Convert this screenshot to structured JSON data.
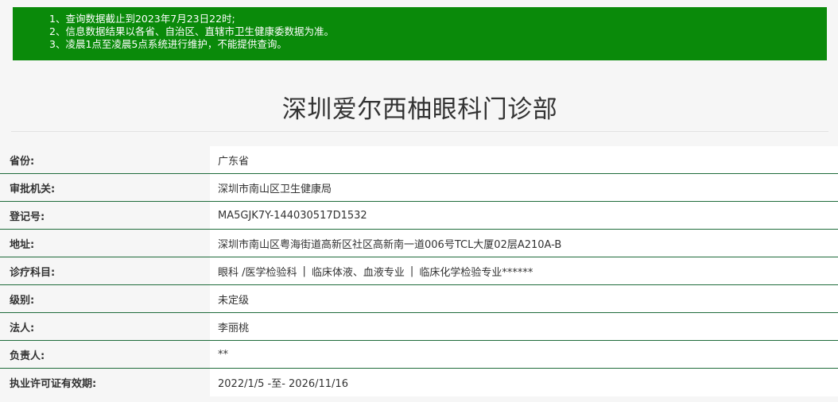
{
  "notice": {
    "lines": [
      "1、查询数据截止到2023年7月23日22时;",
      "2、信息数据结果以各省、自治区、直辖市卫生健康委数据为准。",
      "3、凌晨1点至凌晨5点系统进行维护，不能提供查询。"
    ]
  },
  "title": "深圳爱尔西柚眼科门诊部",
  "rows": [
    {
      "label": "省份:",
      "value": "广东省"
    },
    {
      "label": "审批机关:",
      "value": "深圳市南山区卫生健康局"
    },
    {
      "label": "登记号:",
      "value": "MA5GJK7Y-144030517D1532"
    },
    {
      "label": "地址:",
      "value": "深圳市南山区粤海街道高新区社区高新南一道006号TCL大厦02层A210A-B"
    },
    {
      "label": "诊疗科目:",
      "value_parts": [
        "眼科 /医学检验科",
        "临床体液、血液专业",
        "临床化学检验专业******"
      ],
      "separator": "|"
    },
    {
      "label": "级别:",
      "value": "未定级"
    },
    {
      "label": "法人:",
      "value": "李丽桃"
    },
    {
      "label": "负责人:",
      "value": "**"
    },
    {
      "label": "执业许可证有效期:",
      "value": "2022/1/5 -至- 2026/11/16"
    }
  ]
}
